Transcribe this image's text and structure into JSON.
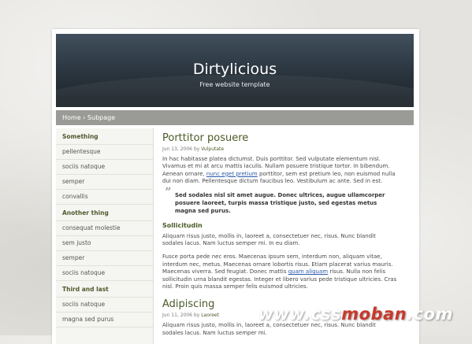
{
  "site": {
    "title": "Dirtylicious",
    "tagline": "Free website template"
  },
  "breadcrumb": {
    "home": "Home",
    "separator": "›",
    "current": "Subpage"
  },
  "sidebar": {
    "groups": [
      {
        "heading": "Something",
        "items": [
          "pellentesque",
          "sociis natoque",
          "semper",
          "convallis"
        ]
      },
      {
        "heading": "Another thing",
        "items": [
          "consequat molestie",
          "sem justo",
          "semper",
          "sociis natoque"
        ]
      },
      {
        "heading": "Third and last",
        "items": [
          "sociis natoque",
          "magna sed purus"
        ]
      }
    ]
  },
  "post1": {
    "title": "Porttitor posuere",
    "date": "Jun 13, 2006",
    "by": "by",
    "author": "Vulputate",
    "p1_a": "In hac habitasse platea dictumst. Duis porttitor. Sed vulputate elementum nisl. Vivamus et mi at arcu mattis iaculis. Nullam posuere tristique tortor. In bibendum. Aenean ornare,",
    "p1_link": "nunc eget pretium",
    "p1_b": "porttitor, sem est pretium leo, non euismod nulla dui non diam. Pellentesque dictum faucibus leo. Vestibulum ac ante. Sed in est.",
    "quote_mark": "”",
    "quote": "Sed sodales nisl sit amet augue. Donec ultrices, augue ullamcorper posuere laoreet, turpis massa tristique justo, sed egestas metus magna sed purus.",
    "subheading": "Sollicitudin",
    "p2": "Aliquam risus justo, mollis in, laoreet a, consectetuer nec, risus. Nunc blandit sodales lacus. Nam luctus semper mi. In eu diam.",
    "p3_a": "Fusce porta pede nec eros. Maecenas ipsum sem, interdum non, aliquam vitae, interdum nec, metus. Maecenas ornare lobortis risus. Etiam placerat varius mauris. Maecenas viverra. Sed feugiat. Donec mattis",
    "p3_link": "quam aliquam",
    "p3_b": "risus. Nulla non felis sollicitudin urna blandit egestas. Integer et libero varius pede tristique ultricies. Cras nisl. Proin quis massa semper felis euismod ultricies."
  },
  "post2": {
    "title": "Adipiscing",
    "date": "Jun 11, 2006",
    "by": "by",
    "author": "Laoreet",
    "p1": "Aliquam risus justo, mollis in, laoreet a, consectetuer nec, risus. Nunc blandit sodales lacus. Nam luctus semper mi."
  },
  "watermark": {
    "prefix": "www.css",
    "middle": "moban",
    "suffix": ".com"
  },
  "colors": {
    "accent_green": "#4b5a28",
    "link_blue": "#2a5aa8",
    "header_dark": "#1c2329",
    "nav_gray": "#9a9a96",
    "watermark_red": "#c8392b"
  }
}
